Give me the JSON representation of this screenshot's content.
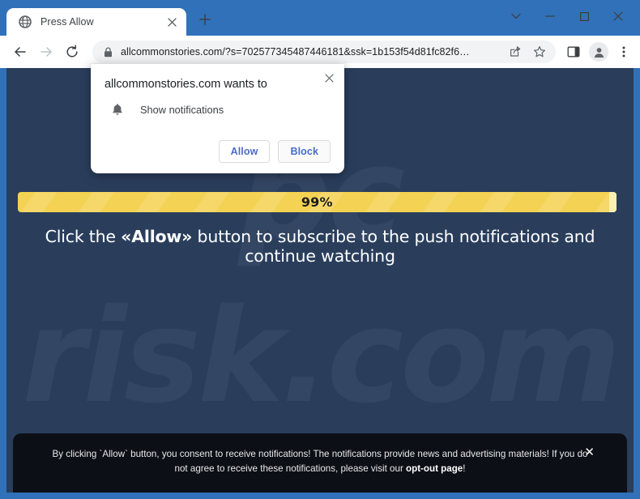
{
  "browser": {
    "tab": {
      "title": "Press Allow",
      "favicon_icon": "globe-icon",
      "close_icon": "close-icon"
    },
    "new_tab_icon": "plus-icon",
    "window_controls": [
      {
        "name": "tab-search",
        "icon": "chevron-down-icon",
        "glyph": "⌄"
      },
      {
        "name": "minimize",
        "icon": "minimize-icon",
        "glyph": "–"
      },
      {
        "name": "maximize",
        "icon": "maximize-icon",
        "glyph": "□"
      },
      {
        "name": "close",
        "icon": "close-icon",
        "glyph": "×"
      }
    ],
    "nav": {
      "back_icon": "back-arrow-icon",
      "forward_icon": "forward-arrow-icon",
      "reload_icon": "reload-icon"
    },
    "omnibox": {
      "lock_icon": "lock-icon",
      "url": "allcommonstories.com/?s=702577345487446181&ssk=1b153f54d81fc82f6…",
      "share_icon": "share-icon",
      "bookmark_icon": "star-icon"
    },
    "toolbar": {
      "side_panel_icon": "side-panel-icon",
      "profile_icon": "profile-avatar-icon",
      "menu_icon": "three-dot-menu-icon"
    },
    "frame_color": "#3071b9"
  },
  "permission_dialog": {
    "title": "allcommonstories.com wants to",
    "permission_icon": "bell-icon",
    "permission_label": "Show notifications",
    "allow_label": "Allow",
    "block_label": "Block",
    "close_icon": "close-icon"
  },
  "page": {
    "background_color": "#2a3e5c",
    "watermark_line1": "pc",
    "watermark_line2": "risk.com",
    "progress": {
      "percent_label": "99%",
      "percent_value": 99,
      "fill_color": "#f4d253",
      "track_color": "#2a3e5c"
    },
    "headline": {
      "before": "Click the ",
      "emphasis": "«Allow»",
      "after": " button to subscribe to the push notifications and continue watching"
    },
    "banner": {
      "text_before": "By clicking `Allow` button, you consent to receive notifications! The notifications provide news and advertising materials! If you do not agree to receive these notifications, please visit our ",
      "link_label": "opt-out page",
      "text_after": "!",
      "close_icon": "close-icon",
      "close_glyph": "✕",
      "background_color": "#0c0f16"
    }
  }
}
